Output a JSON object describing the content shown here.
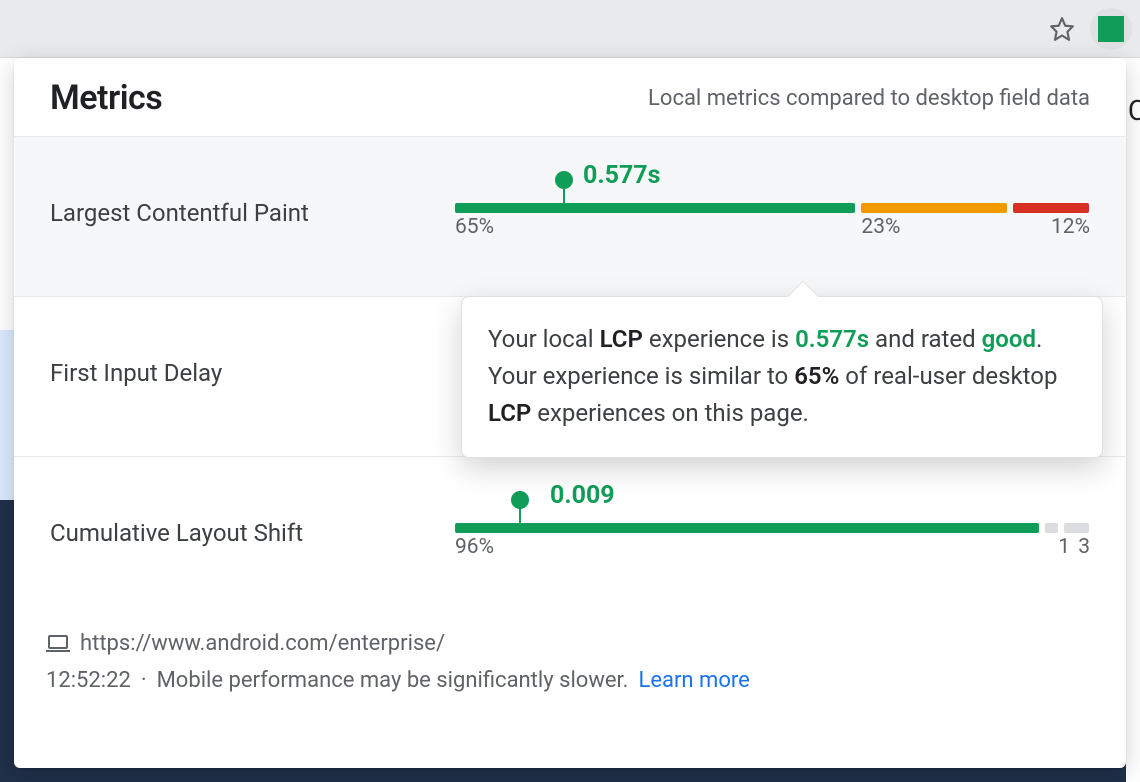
{
  "header": {
    "title": "Metrics",
    "subtitle": "Local metrics compared to desktop field data"
  },
  "tooltip": {
    "prefix": "Your local ",
    "abbr1": "LCP",
    "mid1": " experience is ",
    "value": "0.577s",
    "mid2": " and rated ",
    "rated": "good",
    "mid3": ". Your experience is similar to ",
    "pct": "65%",
    "mid4": " of real-user desktop ",
    "abbr2": "LCP",
    "suffix": " experiences on this page."
  },
  "footer": {
    "url": "https://www.android.com/enterprise/",
    "time": "12:52:22",
    "separator": "·",
    "note": "Mobile performance may be significantly slower.",
    "learn_more": "Learn more"
  },
  "chart_data": [
    {
      "type": "bar",
      "name": "Largest Contentful Paint",
      "value_label": "0.577s",
      "pointer_pct": 17,
      "segments": [
        {
          "bucket": "good",
          "pct": 65,
          "label": "65%"
        },
        {
          "bucket": "ok",
          "pct": 23,
          "label": "23%"
        },
        {
          "bucket": "bad",
          "pct": 12,
          "label": "12%"
        }
      ]
    },
    {
      "type": "bar",
      "name": "First Input Delay",
      "value_label": "",
      "pointer_pct": null,
      "segments": []
    },
    {
      "type": "bar",
      "name": "Cumulative Layout Shift",
      "value_label": "0.009",
      "pointer_pct": 10,
      "segments": [
        {
          "bucket": "good",
          "pct": 96,
          "label": "96%"
        },
        {
          "bucket": "none",
          "pct": 1,
          "label": "1"
        },
        {
          "bucket": "none",
          "pct": 3,
          "label": "3"
        }
      ]
    }
  ]
}
